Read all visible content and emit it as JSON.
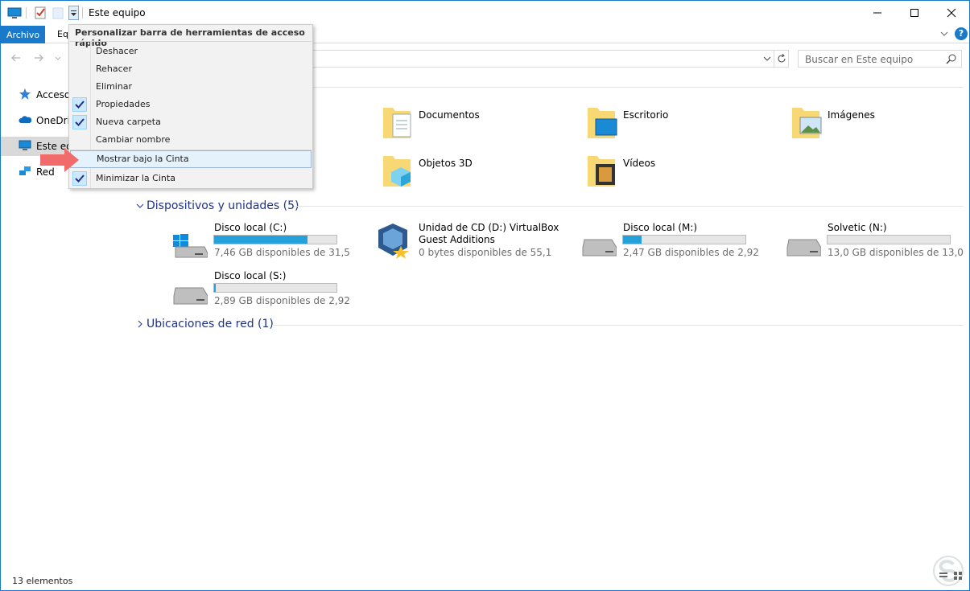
{
  "window": {
    "title": "Este equipo",
    "status_text": "13 elementos"
  },
  "ribbon": {
    "file_tab": "Archivo",
    "tab_partial": "Eq"
  },
  "search": {
    "placeholder": "Buscar en Este equipo"
  },
  "nav_pane": {
    "items": [
      {
        "label": "Acceso",
        "icon": "quick-access-star-icon"
      },
      {
        "label": "OneDri",
        "icon": "onedrive-cloud-icon"
      },
      {
        "label": "Este eq",
        "icon": "this-pc-icon",
        "selected": true
      },
      {
        "label": "Red",
        "icon": "network-icon"
      }
    ]
  },
  "folders": [
    {
      "name": "Documentos",
      "icon": "documents-folder-icon"
    },
    {
      "name": "Escritorio",
      "icon": "desktop-folder-icon"
    },
    {
      "name": "Imágenes",
      "icon": "pictures-folder-icon"
    },
    {
      "name": "Objetos 3D",
      "icon": "3d-objects-folder-icon"
    },
    {
      "name": "Vídeos",
      "icon": "videos-folder-icon"
    }
  ],
  "devices_group": {
    "header": "Dispositivos y unidades (5)",
    "drives": [
      {
        "name": "Disco local (C:)",
        "free_text": "7,46 GB disponibles de 31,5",
        "used_fraction": 0.76,
        "icon": "windows-drive-icon",
        "has_bar": true
      },
      {
        "name": "Unidad de CD (D:) VirtualBox",
        "name_line2": "Guest Additions",
        "free_text": "0 bytes disponibles de 55,1",
        "icon": "virtualbox-cd-icon",
        "has_bar": false
      },
      {
        "name": "Disco local (M:)",
        "free_text": "2,47 GB disponibles de 2,92",
        "used_fraction": 0.15,
        "icon": "hard-drive-icon",
        "has_bar": true
      },
      {
        "name": "Solvetic (N:)",
        "free_text": "13,0 GB disponibles de 13,0",
        "used_fraction": 0.0,
        "icon": "hard-drive-icon",
        "has_bar": true
      },
      {
        "name": "Disco local (S:)",
        "free_text": "2,89 GB disponibles de 2,92",
        "used_fraction": 0.01,
        "icon": "hard-drive-icon",
        "has_bar": true
      }
    ]
  },
  "network_group": {
    "header": "Ubicaciones de red (1)"
  },
  "qat_menu": {
    "title": "Personalizar barra de herramientas de acceso rápido",
    "items": [
      {
        "label": "Deshacer",
        "checked": false
      },
      {
        "label": "Rehacer",
        "checked": false
      },
      {
        "label": "Eliminar",
        "checked": false
      },
      {
        "label": "Propiedades",
        "checked": true
      },
      {
        "label": "Nueva carpeta",
        "checked": true
      },
      {
        "label": "Cambiar nombre",
        "checked": false
      },
      {
        "label": "Mostrar bajo la Cinta",
        "checked": false,
        "hovered": true
      },
      {
        "label": "Minimizar la Cinta",
        "checked": true
      }
    ]
  },
  "colors": {
    "accent": "#1979ca",
    "bar_fill": "#26a0da",
    "group_header": "#1e3287",
    "arrow": "#f26b6b",
    "folder": "#f8d775"
  }
}
